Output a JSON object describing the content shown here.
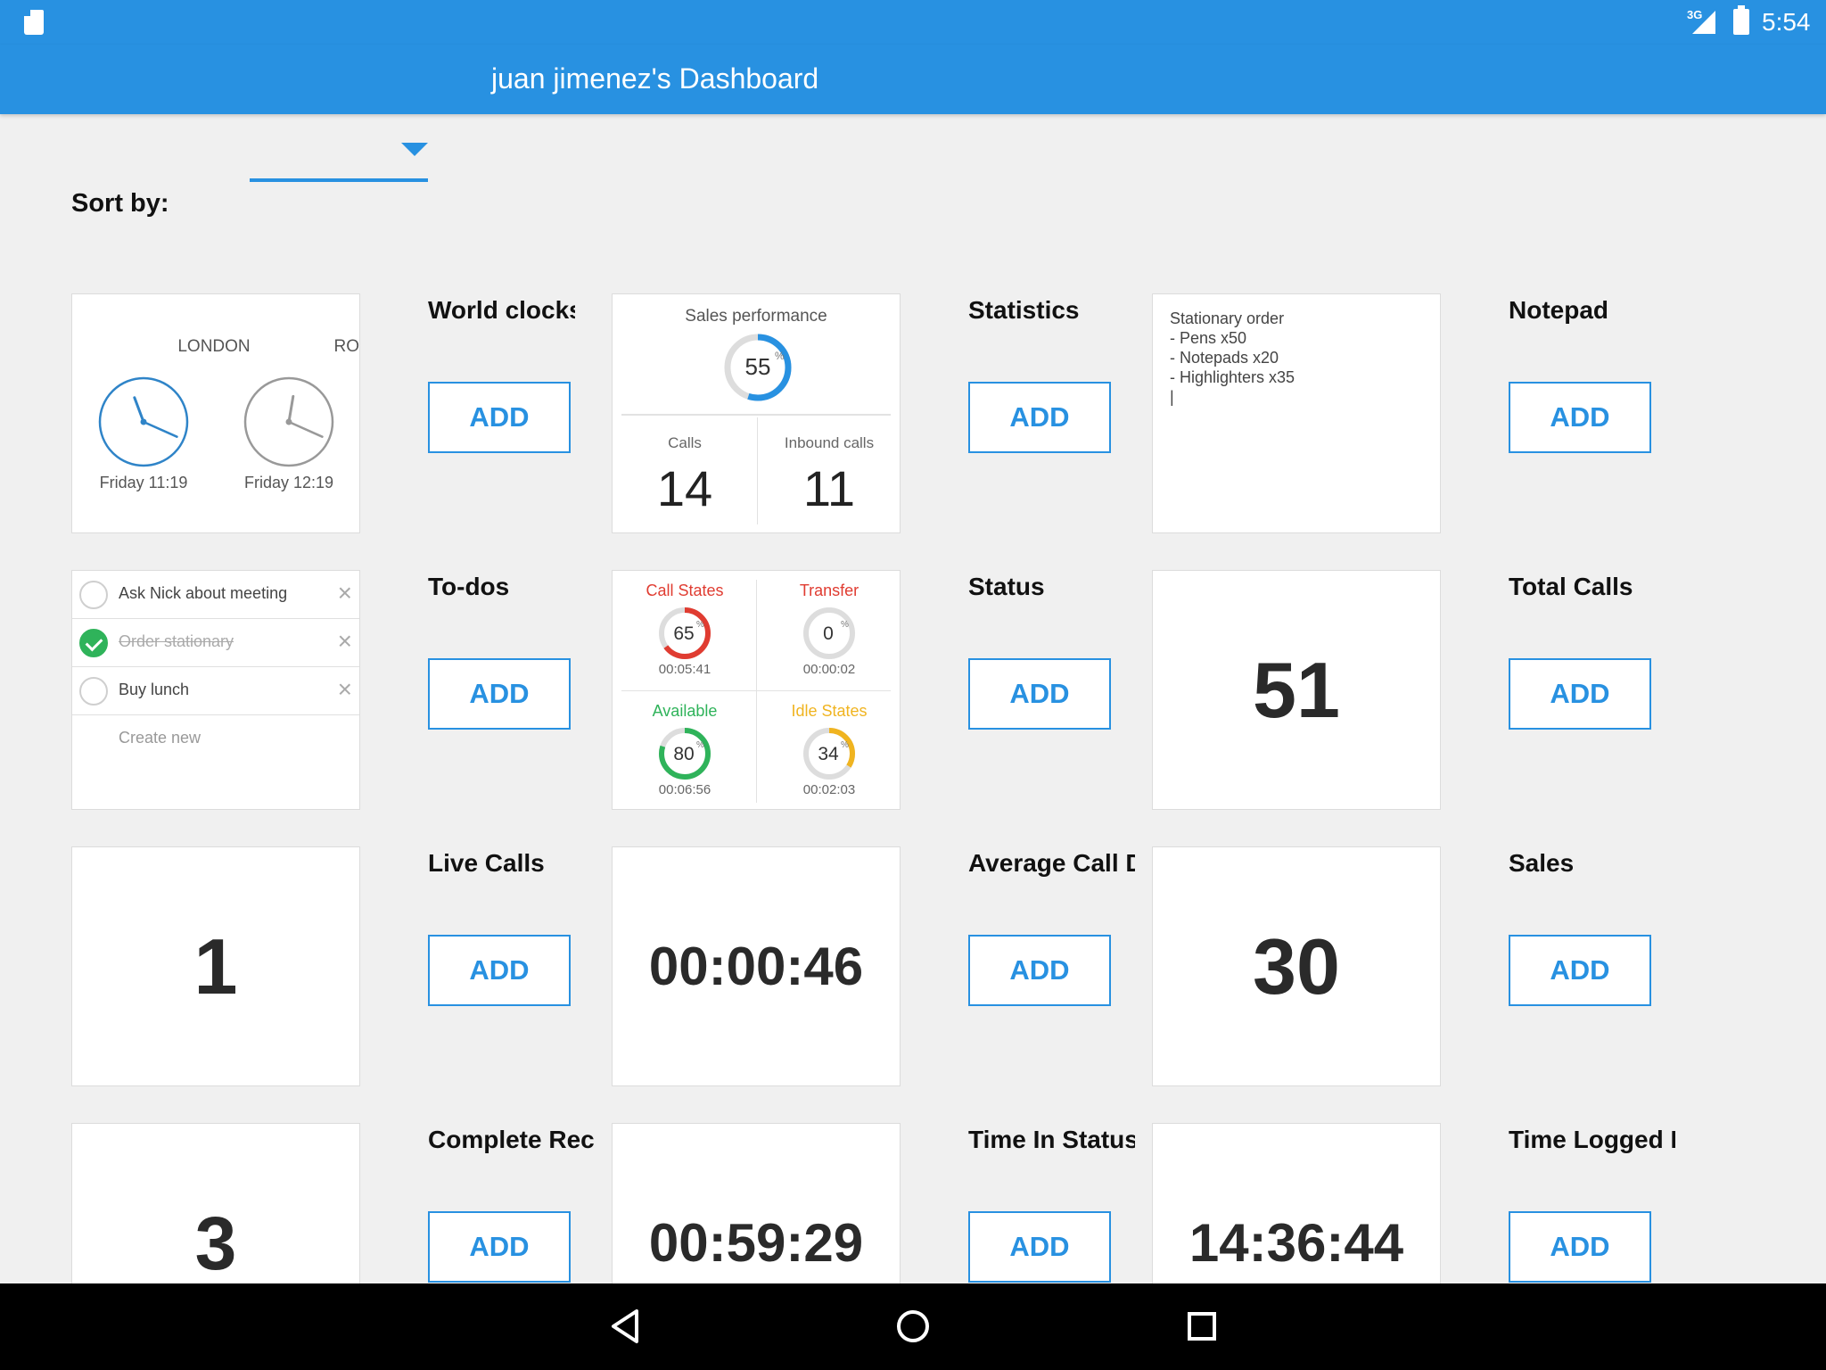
{
  "status_bar": {
    "network": "3G",
    "time": "5:54"
  },
  "app_bar": {
    "title": "juan jimenez's Dashboard"
  },
  "sort": {
    "label": "Sort by:",
    "selected": ""
  },
  "add_label": "ADD",
  "widgets": [
    {
      "title": "World clocks"
    },
    {
      "title": "Statistics"
    },
    {
      "title": "Notepad"
    },
    {
      "title": "To-dos"
    },
    {
      "title": "Status"
    },
    {
      "title": "Total Calls"
    },
    {
      "title": "Live Calls"
    },
    {
      "title": "Average Call Du"
    },
    {
      "title": "Sales"
    },
    {
      "title": "Complete Reco"
    },
    {
      "title": "Time In Status"
    },
    {
      "title": "Time Logged In"
    }
  ],
  "world_clocks": [
    {
      "city": "LONDON",
      "date": "Friday 11:19",
      "hour": 11,
      "minute": 19
    },
    {
      "city": "ROME",
      "date": "Friday 12:19",
      "hour": 12,
      "minute": 19
    }
  ],
  "sales_performance": {
    "title": "Sales performance",
    "percent": 55,
    "percent_text": "55",
    "percent_sign": "%",
    "calls_label": "Calls",
    "calls": "14",
    "inbound_label": "Inbound calls",
    "inbound": "11"
  },
  "notepad": {
    "text": "Stationary order\n- Pens x50\n- Notepads x20\n- Highlighters x35\n|"
  },
  "todos": {
    "items": [
      {
        "text": "Ask Nick about meeting",
        "done": false
      },
      {
        "text": "Order stationary",
        "done": true
      },
      {
        "text": "Buy lunch",
        "done": false
      }
    ],
    "create_label": "Create new"
  },
  "status_states": [
    {
      "title": "Call States",
      "percent": 65,
      "percent_text": "65",
      "time": "00:05:41",
      "color": "#e03c31"
    },
    {
      "title": "Transfer",
      "percent": 0,
      "percent_text": "0",
      "time": "00:00:02",
      "color": "#e03c31"
    },
    {
      "title": "Available",
      "percent": 80,
      "percent_text": "80",
      "time": "00:06:56",
      "color": "#2fb35a"
    },
    {
      "title": "Idle States",
      "percent": 34,
      "percent_text": "34",
      "time": "00:02:03",
      "color": "#f0b420"
    }
  ],
  "total_calls": "51",
  "live_calls": "1",
  "average_call_duration": "00:00:46",
  "sales": "30",
  "complete_records": "3",
  "time_in_status": "00:59:29",
  "time_logged_in": "14:36:44",
  "colors": {
    "primary": "#2891e1",
    "background": "#f0f0f0",
    "ring_track": "#dddddd"
  }
}
